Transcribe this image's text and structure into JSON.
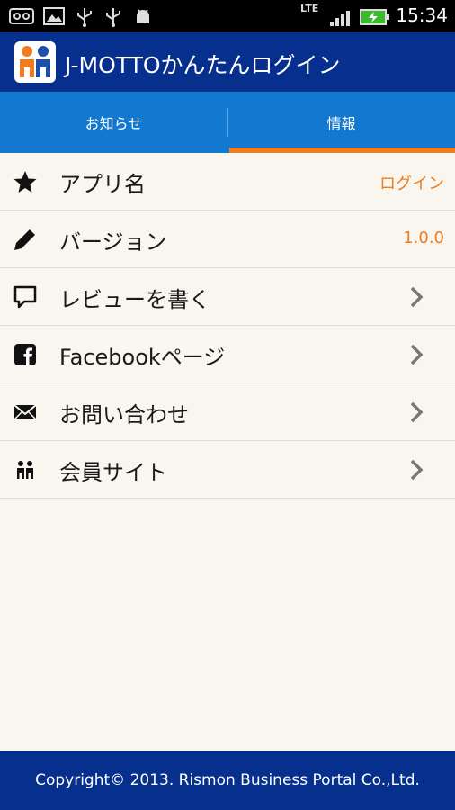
{
  "status_bar": {
    "time": "15:34",
    "network": "LTE",
    "icons": [
      "voicemail-icon",
      "image-icon",
      "usb-icon",
      "usb-icon",
      "android-debug-icon",
      "signal-icon",
      "battery-charging-icon"
    ]
  },
  "app": {
    "title": "J-MOTTOかんたんログイン",
    "logo": "jmotto-logo-icon"
  },
  "tabs": [
    {
      "label": "お知らせ",
      "selected": false
    },
    {
      "label": "情報",
      "selected": true
    }
  ],
  "list": [
    {
      "icon": "star-icon",
      "label": "アプリ名",
      "value": "ログイン"
    },
    {
      "icon": "pencil-icon",
      "label": "バージョン",
      "value": "1.0.0"
    },
    {
      "icon": "speech-bubble-icon",
      "label": "レビューを書く"
    },
    {
      "icon": "facebook-icon",
      "label": "Facebookページ"
    },
    {
      "icon": "envelope-icon",
      "label": "お問い合わせ"
    },
    {
      "icon": "people-icon",
      "label": "会員サイト"
    }
  ],
  "footer": {
    "copyright": "Copyright© 2013. Rismon Business Portal Co.,Ltd."
  },
  "colors": {
    "title_bar": "#062f8e",
    "tab_bar": "#1378cf",
    "accent": "#f07c20",
    "background": "#f8f6ee"
  }
}
